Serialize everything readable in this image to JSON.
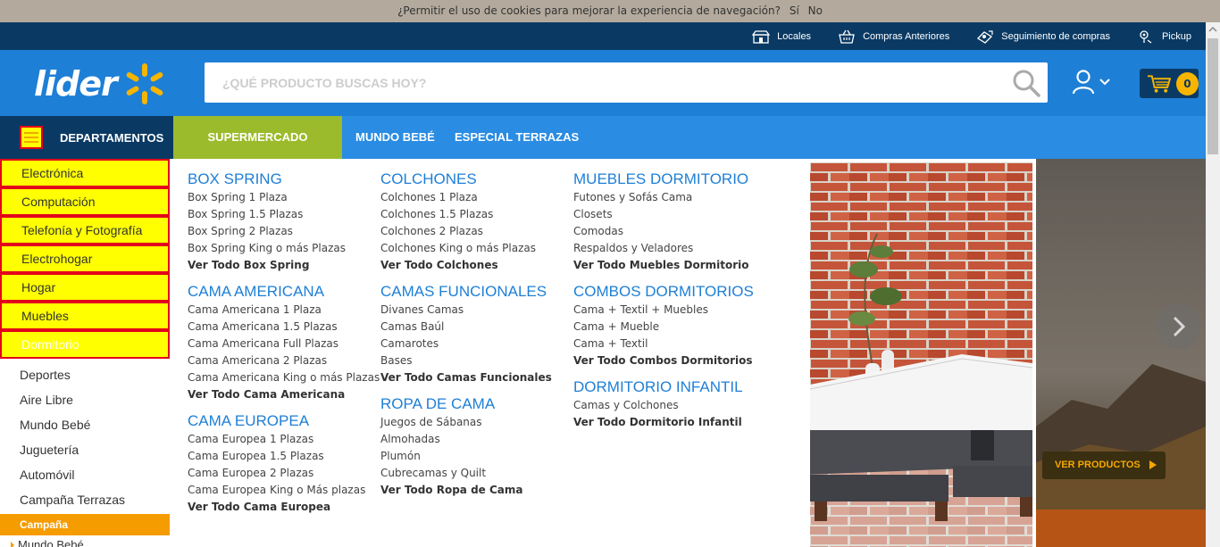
{
  "cookie": {
    "text": "¿Permitir el uso de cookies para mejorar la experiencia de navegación?",
    "yes": "Sí",
    "no": "No"
  },
  "toplinks": [
    {
      "label": "Locales",
      "icon": "store-icon"
    },
    {
      "label": "Compras Anteriores",
      "icon": "basket-icon"
    },
    {
      "label": "Seguimiento de compras",
      "icon": "tracking-icon"
    },
    {
      "label": "Pickup",
      "icon": "pickup-icon"
    }
  ],
  "header": {
    "logo": "lider",
    "search_placeholder": "¿QUÉ PRODUCTO BUSCAS HOY?",
    "cart_count": "0"
  },
  "nav": {
    "departments": "DEPARTAMENTOS",
    "items": [
      "SUPERMERCADO",
      "MUNDO BEBÉ",
      "ESPECIAL TERRAZAS"
    ]
  },
  "sidebar": {
    "highlighted": [
      "Electrónica",
      "Computación",
      "Telefonía y Fotografía",
      "Electrohogar",
      "Hogar",
      "Muebles",
      "Dormitorio"
    ],
    "plain": [
      "Deportes",
      "Aire Libre",
      "Mundo Bebé",
      "Juguetería",
      "Automóvil",
      "Campaña Terrazas"
    ],
    "campaign_title": "Campaña",
    "campaign_items": [
      "Mundo Bebé"
    ]
  },
  "menu": {
    "col1": [
      {
        "title": "BOX SPRING",
        "links": [
          "Box Spring 1 Plaza",
          "Box Spring 1.5 Plazas",
          "Box Spring 2 Plazas",
          "Box Spring King o más Plazas"
        ],
        "all": "Ver Todo Box Spring"
      },
      {
        "title": "CAMA AMERICANA",
        "links": [
          "Cama Americana 1 Plaza",
          "Cama Americana 1.5 Plazas",
          "Cama Americana Full Plazas",
          "Cama Americana 2 Plazas",
          "Cama Americana King o más Plazas"
        ],
        "all": "Ver Todo Cama Americana"
      },
      {
        "title": "CAMA EUROPEA",
        "links": [
          "Cama Europea 1 Plazas",
          "Cama Europea 1.5 Plazas",
          "Cama Europea 2 Plazas",
          "Cama Europea King o Más plazas"
        ],
        "all": "Ver Todo Cama Europea"
      }
    ],
    "col2": [
      {
        "title": "COLCHONES",
        "links": [
          "Colchones 1 Plaza",
          "Colchones 1.5 Plazas",
          "Colchones 2 Plazas",
          "Colchones King o más Plazas"
        ],
        "all": "Ver Todo Colchones"
      },
      {
        "title": "CAMAS FUNCIONALES",
        "links": [
          "Divanes Camas",
          "Camas Baúl",
          "Camarotes",
          "Bases"
        ],
        "all": "Ver Todo Camas Funcionales"
      },
      {
        "title": "ROPA DE CAMA",
        "links": [
          "Juegos de Sábanas",
          "Almohadas",
          "Plumón",
          "Cubrecamas y Quilt"
        ],
        "all": "Ver Todo Ropa de Cama"
      }
    ],
    "col3": [
      {
        "title": "MUEBLES DORMITORIO",
        "links": [
          "Futones y Sofás Cama",
          "Closets",
          "Comodas",
          "Respaldos y Veladores"
        ],
        "all": "Ver Todo Muebles Dormitorio"
      },
      {
        "title": "COMBOS DORMITORIOS",
        "links": [
          "Cama + Textil + Muebles",
          "Cama + Mueble",
          "Cama + Textil"
        ],
        "all": "Ver Todo Combos Dormitorios"
      },
      {
        "title": "DORMITORIO INFANTIL",
        "links": [
          "Camas y Colchones"
        ],
        "all": "Ver Todo Dormitorio Infantil"
      }
    ]
  },
  "hero": {
    "cta": "VER PRODUCTOS"
  }
}
